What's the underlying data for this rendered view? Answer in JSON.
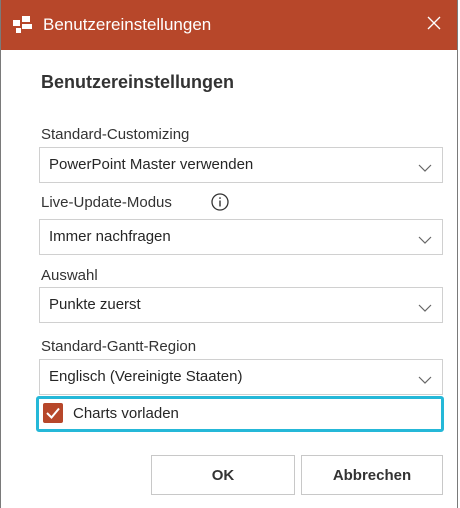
{
  "window": {
    "title": "Benutzereinstellungen",
    "title_bar_color": "#b7472a",
    "app_icon": "powerpoint-addin-icon",
    "close_icon": "close-icon"
  },
  "dialog": {
    "heading": "Benutzereinstellungen"
  },
  "fields": {
    "customizing": {
      "label": "Standard-Customizing",
      "value": "PowerPoint Master verwenden"
    },
    "live_update": {
      "label": "Live-Update-Modus",
      "value": "Immer nachfragen",
      "info_icon": "info-icon"
    },
    "selection": {
      "label": "Auswahl",
      "value": "Punkte zuerst"
    },
    "gantt_region": {
      "label": "Standard-Gantt-Region",
      "value": "Englisch (Vereinigte Staaten)"
    }
  },
  "preload_charts": {
    "label": "Charts vorladen",
    "checked": true,
    "highlight_color": "#25b8d8"
  },
  "buttons": {
    "ok": "OK",
    "cancel": "Abbrechen"
  }
}
